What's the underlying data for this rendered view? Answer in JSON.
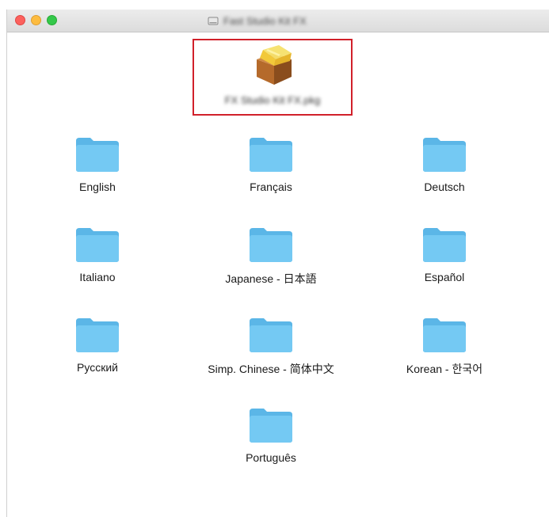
{
  "window": {
    "title": "Fast Studio Kit FX"
  },
  "package": {
    "name": "FX Studio Kit FX.pkg",
    "icon": "installer-package-icon"
  },
  "folders": [
    {
      "label": "English",
      "icon": "folder-icon"
    },
    {
      "label": "Français",
      "icon": "folder-icon"
    },
    {
      "label": "Deutsch",
      "icon": "folder-icon"
    },
    {
      "label": "Italiano",
      "icon": "folder-icon"
    },
    {
      "label": "Japanese - 日本語",
      "icon": "folder-icon"
    },
    {
      "label": "Español",
      "icon": "folder-icon"
    },
    {
      "label": "Русский",
      "icon": "folder-icon"
    },
    {
      "label": "Simp. Chinese - 简体中文",
      "icon": "folder-icon"
    },
    {
      "label": "Korean - 한국어",
      "icon": "folder-icon"
    },
    {
      "label": "Português",
      "icon": "folder-icon"
    }
  ],
  "colors": {
    "highlight": "#d1202a",
    "folder_body": "#74c9f3",
    "folder_tab": "#5bb6e7"
  }
}
